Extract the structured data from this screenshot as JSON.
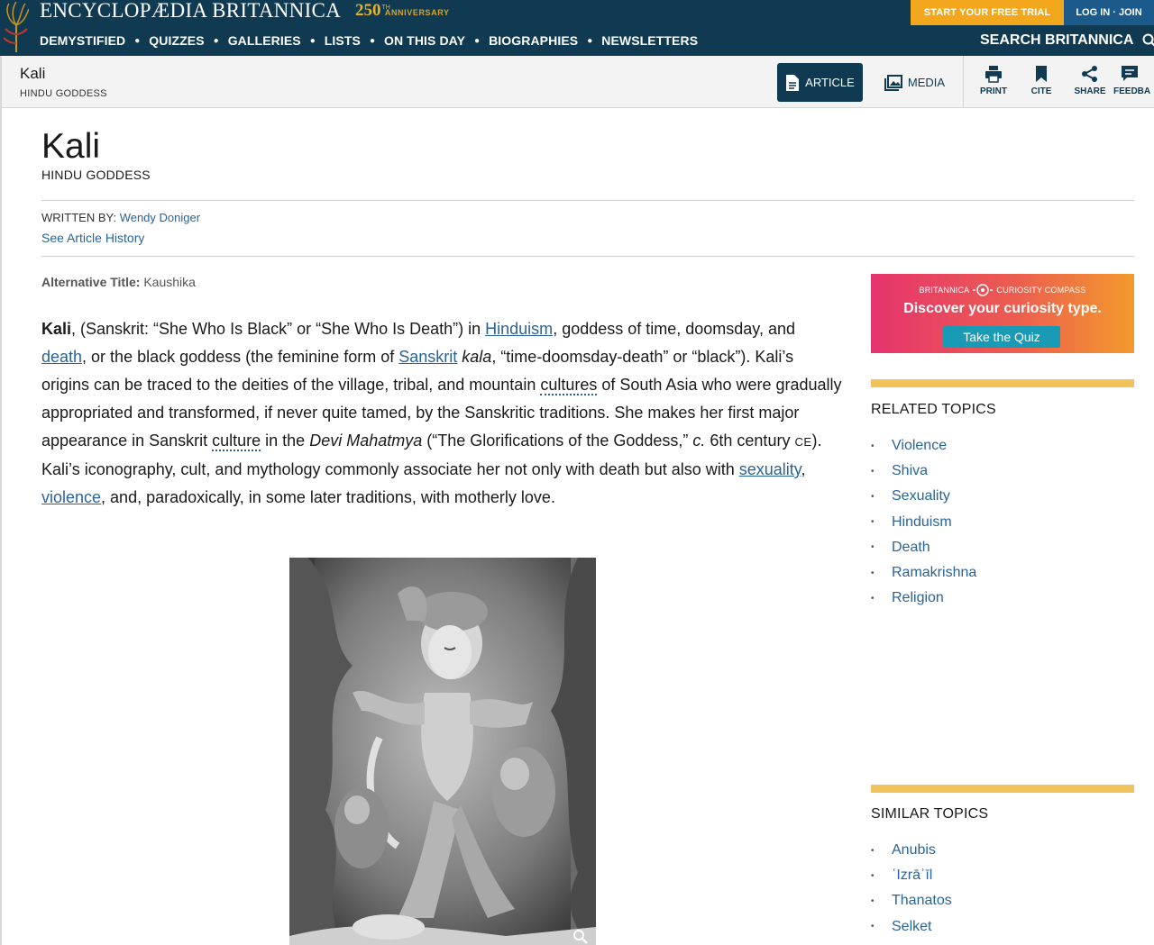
{
  "header": {
    "brand": "ENCYCLOPÆDIA BRITANNICA",
    "anniversary_number": "250",
    "anniversary_suffix": "TH",
    "anniversary_word": "ANNIVERSARY",
    "trial_label": "START YOUR FREE TRIAL",
    "login_label": "LOG IN · JOIN",
    "nav": [
      "DEMYSTIFIED",
      "QUIZZES",
      "GALLERIES",
      "LISTS",
      "ON THIS DAY",
      "BIOGRAPHIES",
      "NEWSLETTERS"
    ],
    "search_label": "SEARCH BRITANNICA"
  },
  "subbar": {
    "title": "Kali",
    "subtitle": "HINDU GODDESS",
    "article_label": "ARTICLE",
    "media_label": "MEDIA",
    "tools": [
      "PRINT",
      "CITE",
      "SHARE",
      "FEEDBA"
    ]
  },
  "article": {
    "title": "Kali",
    "subtitle": "HINDU GODDESS",
    "written_by_label": "WRITTEN BY:",
    "author": "Wendy Doniger",
    "history_link": "See Article History",
    "alt_title_label": "Alternative Title:",
    "alt_title_value": "Kaushika",
    "body": {
      "t1": "Kali",
      "t2": ", (Sanskrit: “She Who Is Black” or “She Who Is Death”) in ",
      "l_hinduism": "Hinduism",
      "t3": ", goddess of time, doomsday, and ",
      "l_death": "death",
      "t4": ", or the black goddess (the feminine form of ",
      "l_sanskrit": "Sanskrit",
      "t5": " ",
      "i_kala": "kala",
      "t6": ", “time-doomsday-death” or “black”). Kali’s origins can be traced to the deities of the village, tribal, and mountain ",
      "d_cultures": "cultures",
      "t7": " of South Asia who were gradually appropriated and transformed, if never quite tamed, by the Sanskritic traditions. She makes her first major appearance in Sanskrit ",
      "d_culture": "culture",
      "t8": " in the ",
      "i_devi": "Devi Mahatmya",
      "t9": " (“The Glorifications of the Goddess,” ",
      "i_c": "c.",
      "t10": " 6th century ",
      "sc_ce": "CE",
      "t11": "). Kali’s iconography, cult, and mythology commonly associate her not only with death but also with ",
      "l_sexuality": "sexuality",
      "t12": ", ",
      "l_violence": "violence",
      "t13": ", and, paradoxically, in some later traditions, with motherly love."
    }
  },
  "sidebar": {
    "promo": {
      "brand_left": "BRITANNICA",
      "brand_right": "CURIOSITY COMPASS",
      "headline": "Discover your curiosity type.",
      "button": "Take the Quiz"
    },
    "related_heading": "RELATED TOPICS",
    "related": [
      "Violence",
      "Shiva",
      "Sexuality",
      "Hinduism",
      "Death",
      "Ramakrishna",
      "Religion"
    ],
    "similar_heading": "SIMILAR TOPICS",
    "similar": [
      "Anubis",
      "ʿIzrāʾīl",
      "Thanatos",
      "Selket"
    ],
    "bullet": "•"
  },
  "colors": {
    "header_bg": "#0f3a52",
    "trial_bg": "#f2a71d",
    "login_bg": "#1b5a8a",
    "link": "#2a6496",
    "gold_bar": "#f1c35b"
  }
}
